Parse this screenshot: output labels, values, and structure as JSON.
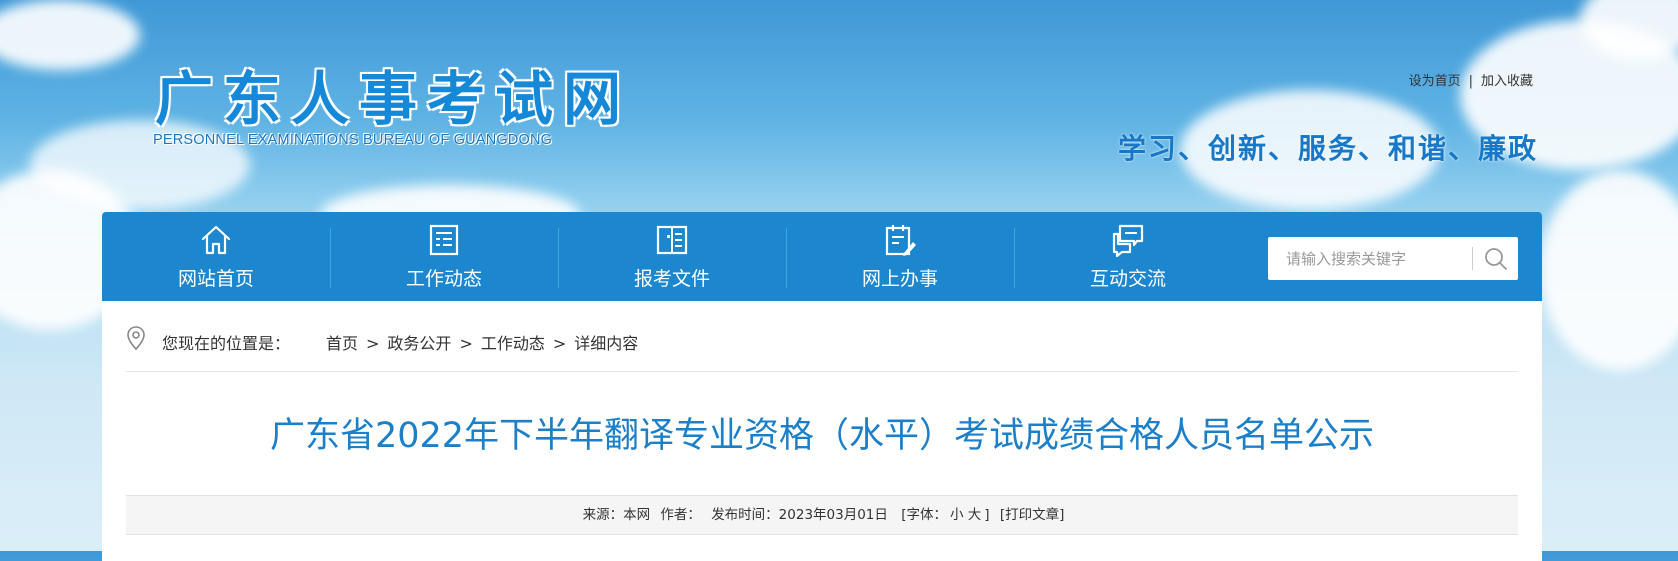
{
  "header": {
    "logo_title": "广东人事考试网",
    "logo_subtitle": "PERSONNEL EXAMINATIONS BUREAU OF GUANGDONG",
    "top_links": [
      "设为首页",
      "加入收藏"
    ],
    "top_links_separator": "|",
    "slogan": "学习、创新、服务、和谐、廉政"
  },
  "nav": {
    "items": [
      {
        "label": "网站首页",
        "icon": "home-icon"
      },
      {
        "label": "工作动态",
        "icon": "news-list-icon"
      },
      {
        "label": "报考文件",
        "icon": "open-book-icon"
      },
      {
        "label": "网上办事",
        "icon": "clipboard-pen-icon"
      },
      {
        "label": "互动交流",
        "icon": "chat-bubbles-icon"
      }
    ],
    "search": {
      "placeholder": "请输入搜索关键字",
      "value": ""
    }
  },
  "breadcrumb": {
    "prefix": "您现在的位置是：",
    "items": [
      "首页",
      "政务公开",
      "工作动态",
      "详细内容"
    ],
    "separator": ">"
  },
  "article": {
    "title": "广东省2022年下半年翻译专业资格（水平）考试成绩合格人员名单公示",
    "meta": {
      "source_label": "来源：本网",
      "author_label": "作者：",
      "date_label": "发布时间：2023年03月01日",
      "font_open": "[字体：",
      "font_small": "小",
      "font_large": "大",
      "font_close": "]",
      "print_label": "[打印文章]"
    }
  },
  "colors": {
    "nav_bg": "#1c86cf",
    "title_blue": "#1c7fc9",
    "slogan_blue": "#1878c8"
  }
}
